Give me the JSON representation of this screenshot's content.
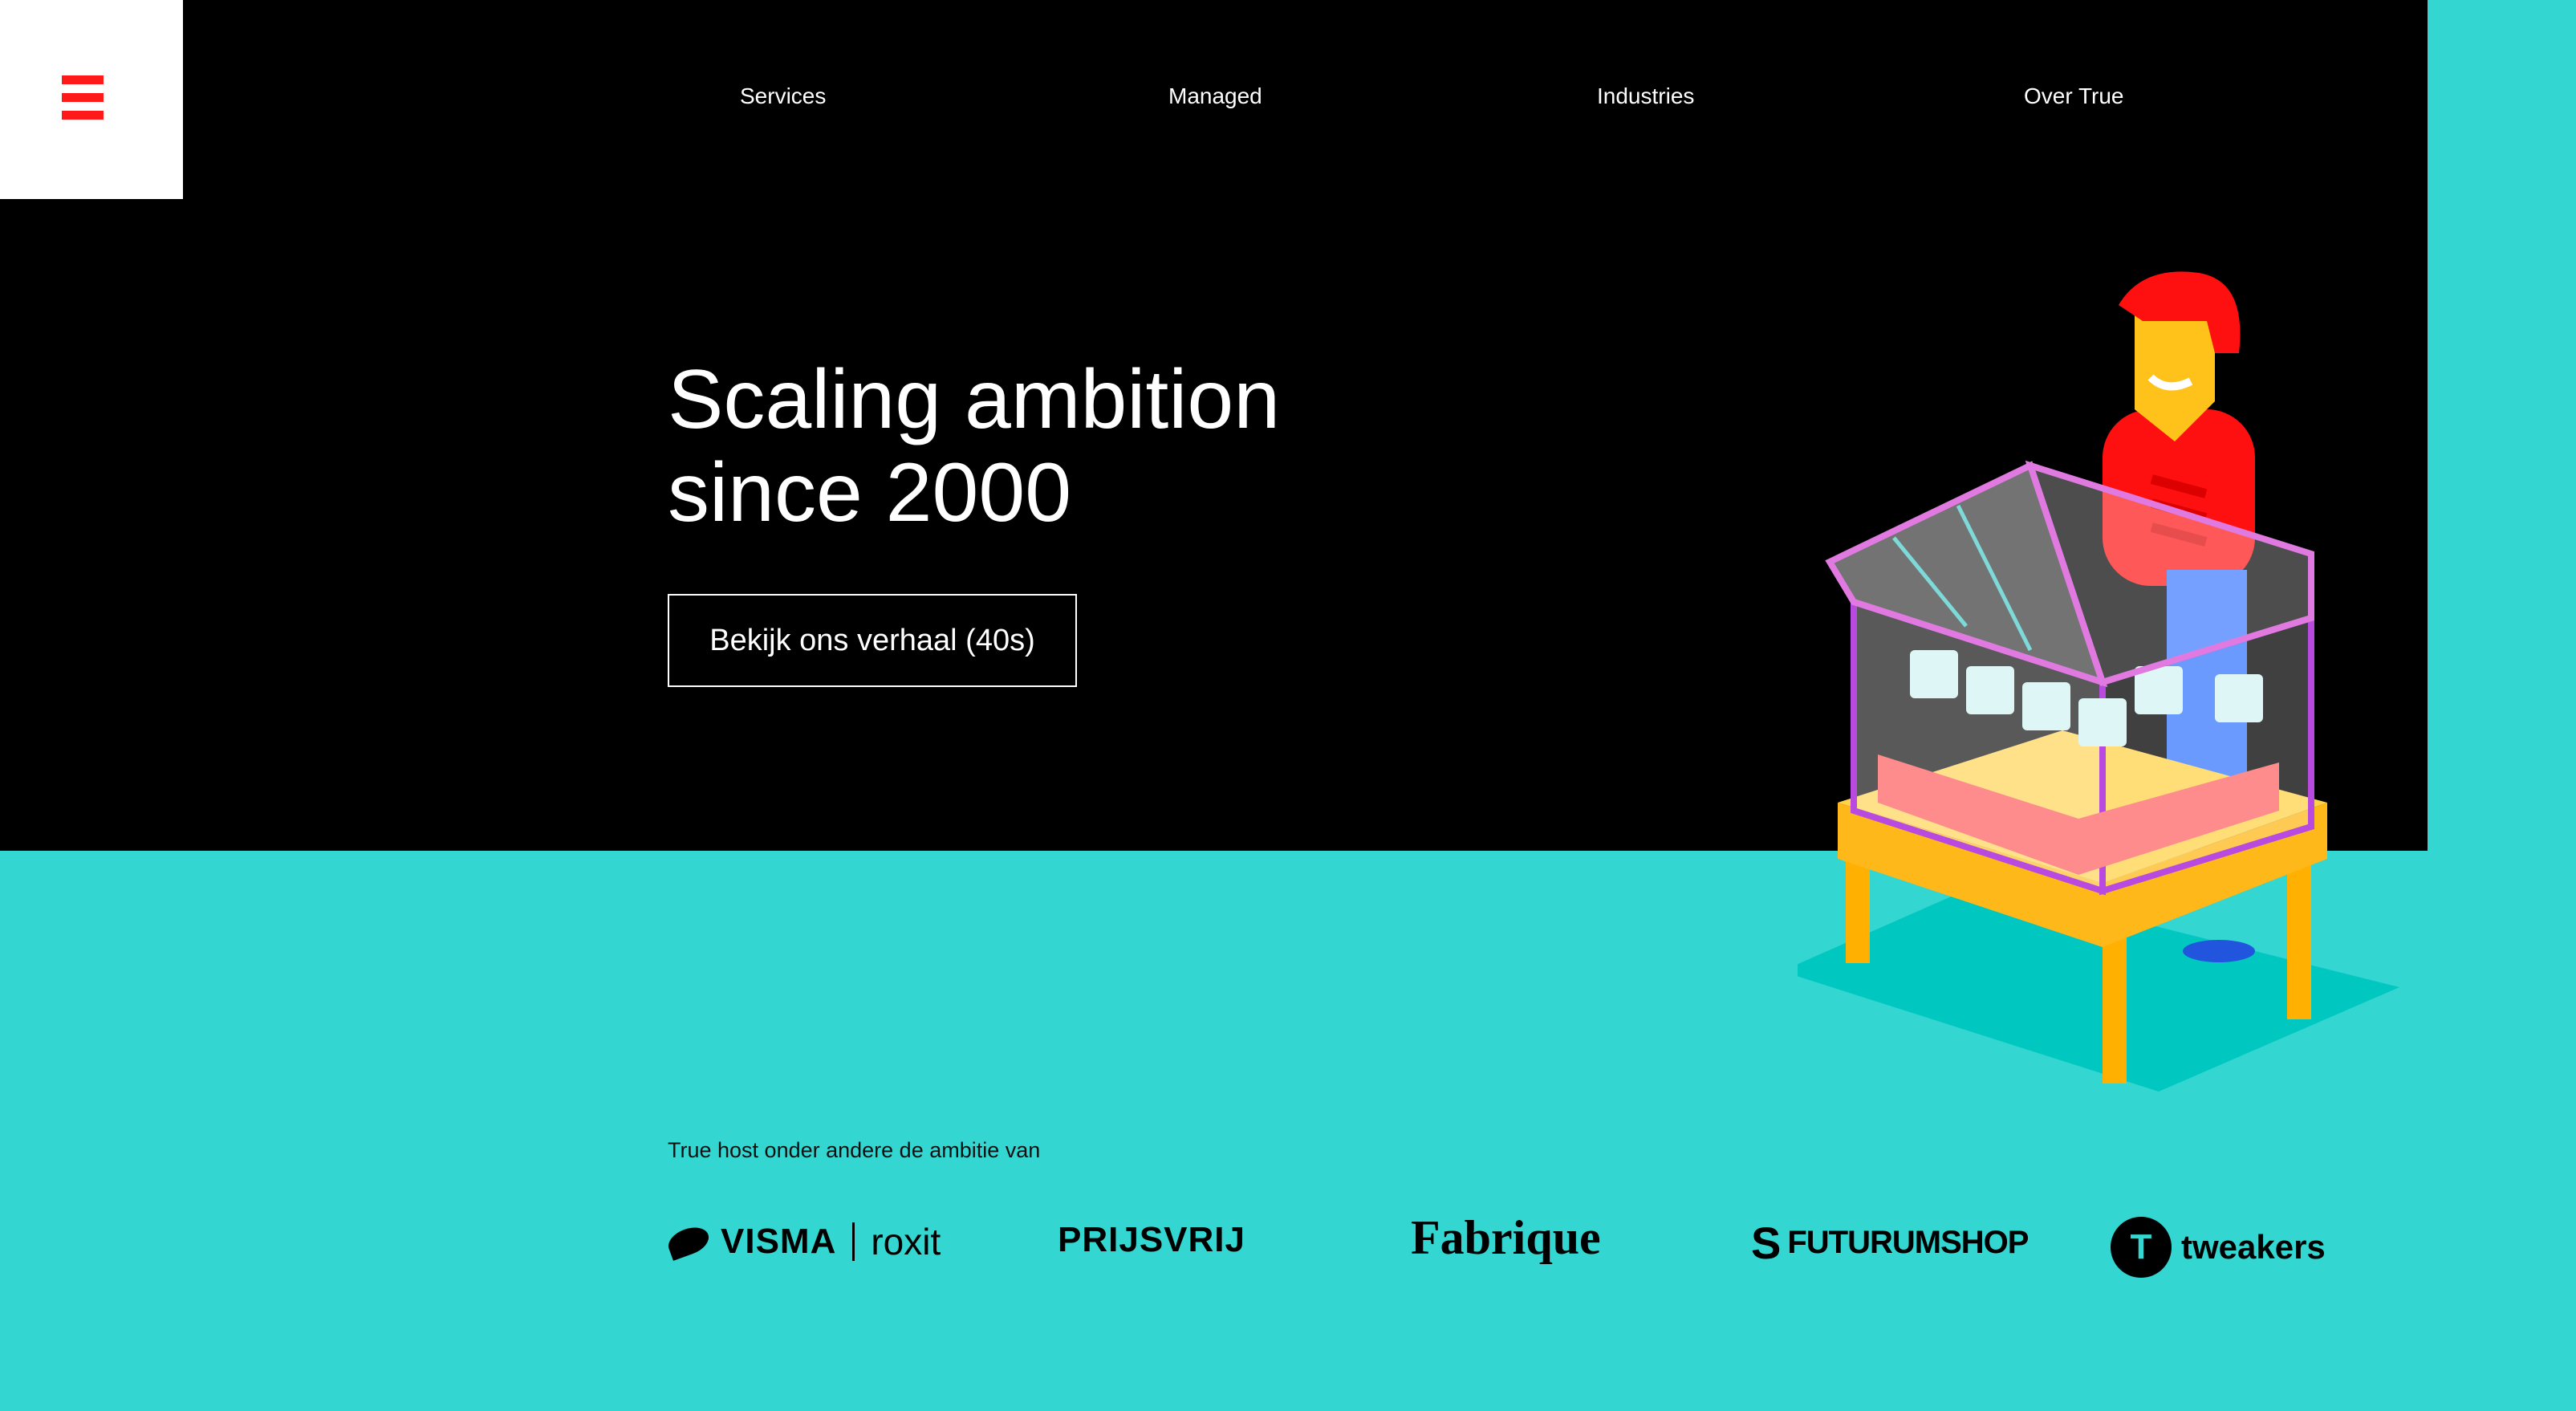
{
  "nav": {
    "items": [
      {
        "label": "Services"
      },
      {
        "label": "Managed"
      },
      {
        "label": "Industries"
      },
      {
        "label": "Over True"
      }
    ]
  },
  "hero": {
    "headline_line1": "Scaling ambition",
    "headline_line2": "since 2000",
    "cta_label": "Bekijk ons verhaal (40s)"
  },
  "clients": {
    "intro": "True host onder andere de ambitie van",
    "logos": [
      {
        "brand": "VISMA",
        "sub": "roxit"
      },
      {
        "brand": "PRIJSVRIJ"
      },
      {
        "brand": "Fabrique"
      },
      {
        "brand": "FUTURUMSHOP"
      },
      {
        "brand": "tweakers"
      }
    ]
  },
  "colors": {
    "hero_bg": "#000000",
    "page_bg": "#33d6d0",
    "accent": "#ff1a1a"
  },
  "icons": {
    "menu": "hamburger-icon",
    "illustration": "greenhouse-gardener-illustration"
  }
}
